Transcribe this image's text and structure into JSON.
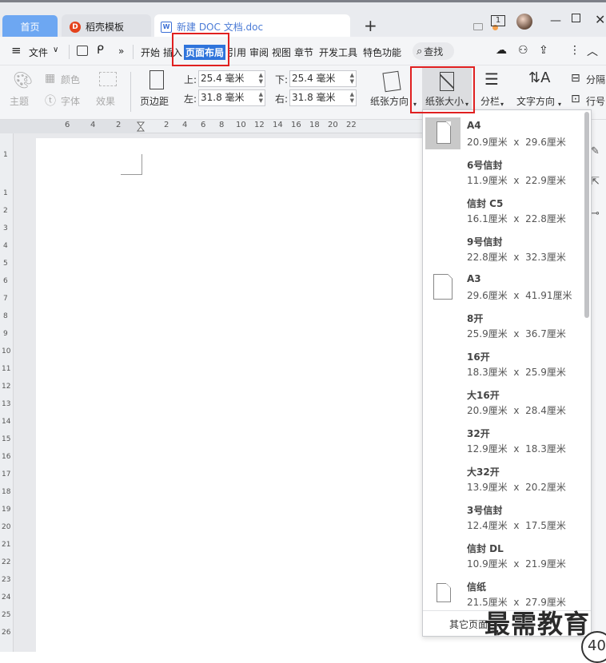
{
  "tabs": {
    "home": "首页",
    "daoke": "稻壳模板",
    "doc": "新建 DOC 文档.doc",
    "win_badge": "1"
  },
  "menu": {
    "file": "文件",
    "items": [
      "开始",
      "插入",
      "页面布局",
      "引用",
      "审阅",
      "视图",
      "章节",
      "开发工具",
      "特色功能"
    ],
    "search": "查找"
  },
  "toolbar": {
    "theme": "主题",
    "color": "颜色",
    "font": "字体",
    "effect": "效果",
    "margins": "页边距",
    "top_label": "上:",
    "top_value": "25.4 毫米",
    "bottom_label": "下:",
    "bottom_value": "25.4 毫米",
    "left_label": "左:",
    "left_value": "31.8 毫米",
    "right_label": "右:",
    "right_value": "31.8 毫米",
    "orientation": "纸张方向",
    "paper_size": "纸张大小",
    "columns": "分栏",
    "text_direction": "文字方向",
    "break": "分隔",
    "row": "行号"
  },
  "ruler": {
    "h": [
      "6",
      "4",
      "2",
      "2",
      "4",
      "6",
      "8",
      "10",
      "12",
      "14",
      "16",
      "18",
      "20",
      "22"
    ],
    "v": [
      "1",
      "1",
      "2",
      "3",
      "4",
      "5",
      "6",
      "7",
      "8",
      "9",
      "10",
      "11",
      "12",
      "13",
      "14",
      "15",
      "16",
      "17",
      "18",
      "19",
      "20",
      "21",
      "22",
      "23",
      "24",
      "25",
      "26"
    ]
  },
  "paper_sizes": [
    {
      "name": "A4",
      "w": "20.9厘米",
      "h": "29.6厘米",
      "selected": true,
      "icon": true
    },
    {
      "name": "6号信封",
      "w": "11.9厘米",
      "h": "22.9厘米"
    },
    {
      "name": "信封 C5",
      "w": "16.1厘米",
      "h": "22.8厘米"
    },
    {
      "name": "9号信封",
      "w": "22.8厘米",
      "h": "32.3厘米"
    },
    {
      "name": "A3",
      "w": "29.6厘米",
      "h": "41.91厘米",
      "icon": true
    },
    {
      "name": "8开",
      "w": "25.9厘米",
      "h": "36.7厘米"
    },
    {
      "name": "16开",
      "w": "18.3厘米",
      "h": "25.9厘米"
    },
    {
      "name": "大16开",
      "w": "20.9厘米",
      "h": "28.4厘米"
    },
    {
      "name": "32开",
      "w": "12.9厘米",
      "h": "18.3厘米"
    },
    {
      "name": "大32开",
      "w": "13.9厘米",
      "h": "20.2厘米"
    },
    {
      "name": "3号信封",
      "w": "12.4厘米",
      "h": "17.5厘米"
    },
    {
      "name": "信封 DL",
      "w": "10.9厘米",
      "h": "21.9厘米"
    },
    {
      "name": "信纸",
      "w": "21.5厘米",
      "h": "27.9厘米",
      "icon": true
    }
  ],
  "times": "x",
  "other_sizes": "其它页面",
  "watermark": "最需教育",
  "badge": "40"
}
